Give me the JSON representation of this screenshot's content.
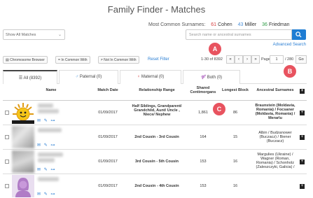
{
  "page": {
    "title": "Family Finder - Matches"
  },
  "surnames": {
    "label": "Most Common Surnames:",
    "items": [
      {
        "count": "61",
        "name": "Cohen",
        "color": "#d63b3b"
      },
      {
        "count": "43",
        "name": "Miller",
        "color": "#4a90d9"
      },
      {
        "count": "36",
        "name": "Friedman",
        "color": "#2e9b45"
      }
    ]
  },
  "filter": {
    "selected": "Show All Matches"
  },
  "search": {
    "placeholder": "Search name or ancestral surnames",
    "advanced": "Advanced Search"
  },
  "toolbar": {
    "chromosome": "Chromosome Browser",
    "in_common": "In Common With",
    "not_in_common": "Not In Common With",
    "reset": "Reset Filter"
  },
  "pagination": {
    "range": "1-30 of 8392",
    "first": "«",
    "prev": "‹",
    "next": "›",
    "last": "»",
    "page_label": "Page",
    "page_value": "1",
    "total": "/ 280",
    "go": "Go"
  },
  "markers": {
    "a": "A",
    "b": "B",
    "c": "C"
  },
  "tabs": [
    {
      "label": "All (8392)",
      "icon": "list-icon"
    },
    {
      "label": "Paternal (0)",
      "icon": "male-icon"
    },
    {
      "label": "Maternal (0)",
      "icon": "female-icon"
    },
    {
      "label": "Both (0)",
      "icon": "couple-icon"
    }
  ],
  "table": {
    "headers": {
      "name": "Name",
      "match_date": "Match Date",
      "relationship": "Relationship Range",
      "shared": "Shared Centimorgans",
      "longest": "Longest Block",
      "ancestral": "Ancestral Surnames"
    },
    "rows": [
      {
        "date": "01/09/2017",
        "relationship": "Half Siblings, Grandparent/ Grandchild, Aunt/ Uncle , Niece/ Nephew",
        "shared": "1,861",
        "longest": "86",
        "ancestral": "Braunstein (Moldavia, Romania) / Focsaner (Moldavia, Romania) / Merarlu",
        "avatar": "sun"
      },
      {
        "date": "01/09/2017",
        "relationship": "2nd Cousin - 3rd Cousin",
        "shared": "164",
        "longest": "15",
        "ancestral": "Albin / Budzanower (Buczacz) / Biener (Buczacz)",
        "avatar": "photo"
      },
      {
        "date": "01/09/2017",
        "relationship": "3rd Cousin - 5th Cousin",
        "shared": "153",
        "longest": "16",
        "ancestral": "Margulies (Ukraine) / Wagner (Roman, Romania) / Schonholz (Zaleszczyki, Galicia) /",
        "avatar": "photo"
      },
      {
        "date": "01/09/2017",
        "relationship": "2nd Cousin - 4th Cousin",
        "shared": "153",
        "longest": "16",
        "ancestral": "",
        "avatar": "female"
      }
    ]
  }
}
